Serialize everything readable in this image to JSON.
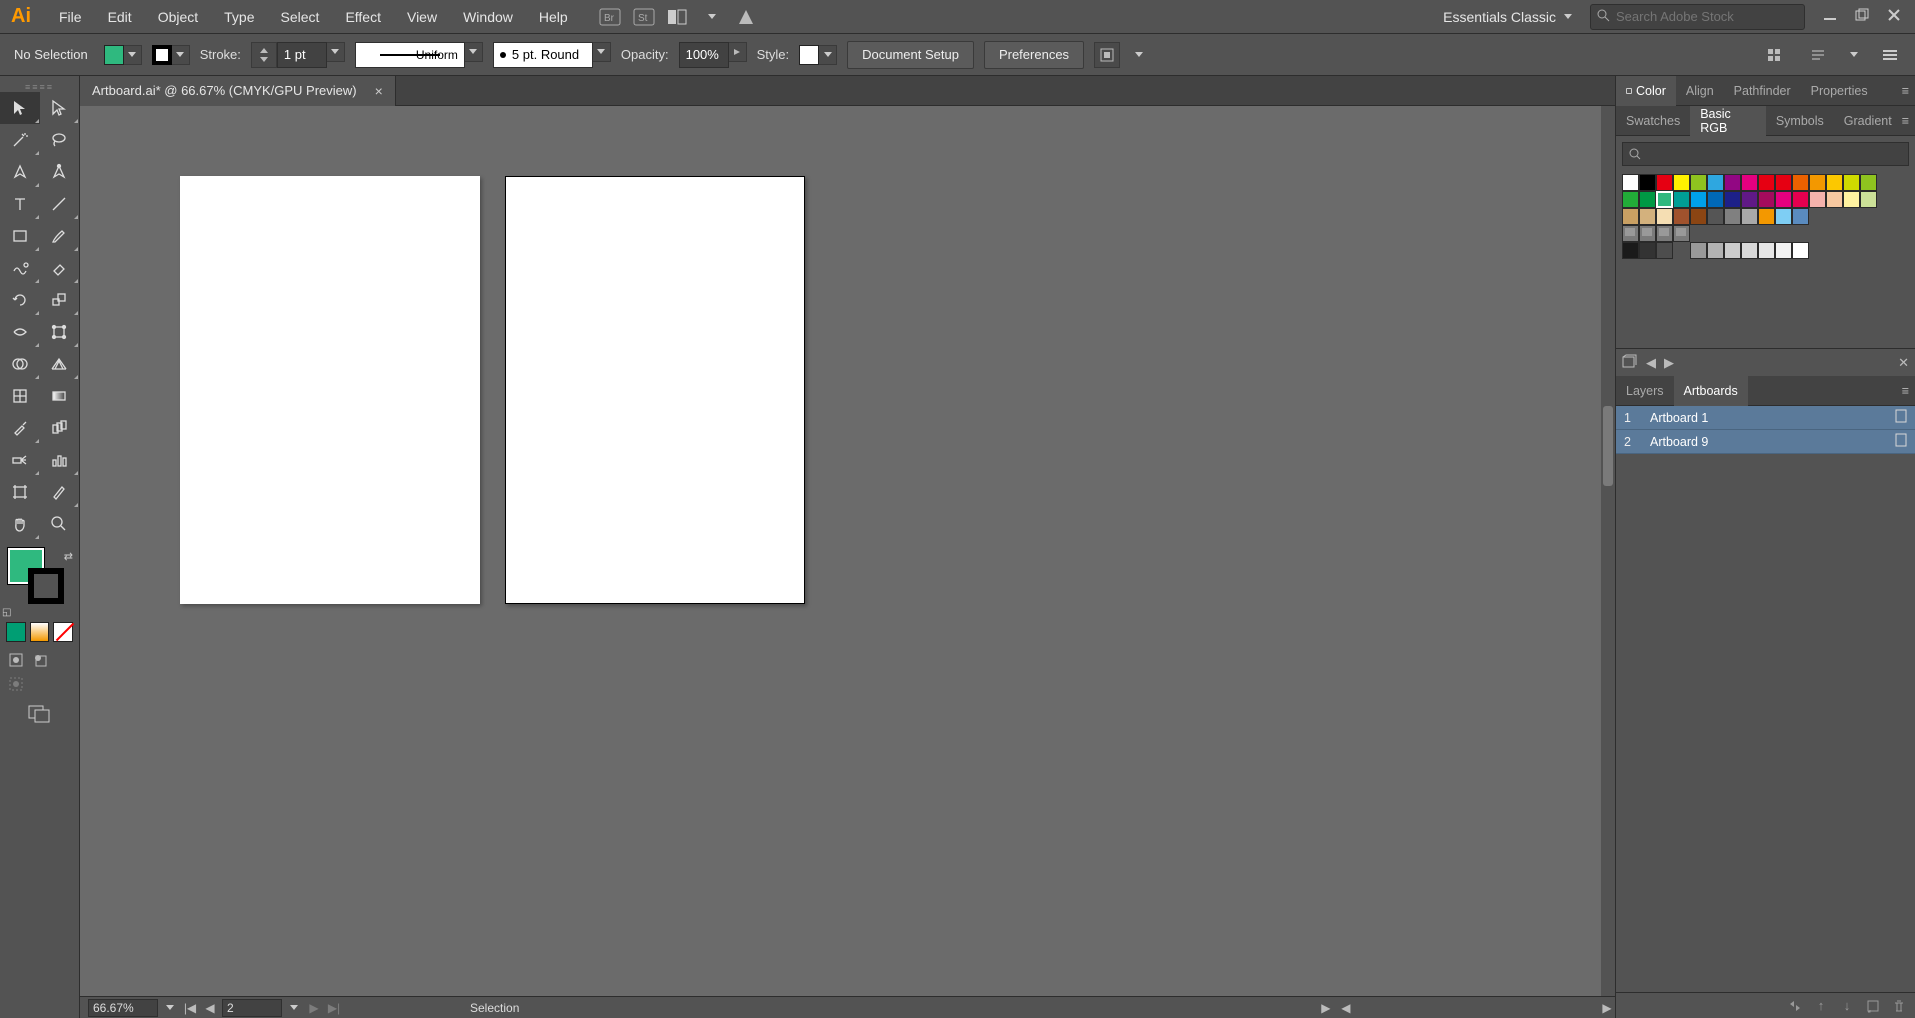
{
  "menu": {
    "items": [
      "File",
      "Edit",
      "Object",
      "Type",
      "Select",
      "Effect",
      "View",
      "Window",
      "Help"
    ]
  },
  "workspace": {
    "name": "Essentials Classic"
  },
  "search": {
    "placeholder": "Search Adobe Stock"
  },
  "options": {
    "selection": "No Selection",
    "fill_color": "#2fb97f",
    "stroke_color": "#000000",
    "stroke_label": "Stroke:",
    "stroke_weight": "1 pt",
    "profile_label": "Uniform",
    "brush_label": "5 pt. Round",
    "opacity_label": "Opacity:",
    "opacity_value": "100%",
    "style_label": "Style:",
    "btn_docsetup": "Document Setup",
    "btn_prefs": "Preferences"
  },
  "doc_tab": {
    "title": "Artboard.ai* @ 66.67% (CMYK/GPU Preview)"
  },
  "status": {
    "zoom": "66.67%",
    "artboard_num": "2",
    "tool": "Selection"
  },
  "right_tabs1": [
    "Color",
    "Align",
    "Pathfinder",
    "Properties"
  ],
  "right_tabs2": [
    "Swatches",
    "Basic RGB",
    "Symbols",
    "Gradient"
  ],
  "swatches_row1": [
    "#ffffff",
    "#000000",
    "#e60012",
    "#fff100",
    "#8fc31f",
    "#2ea7e0",
    "#920783",
    "#e4007f",
    "#e60012",
    "#e60012",
    "#eb6100",
    "#f39800",
    "#fcc800",
    "#cfdb00",
    "#8fc31f"
  ],
  "swatches_row2": [
    "#22ac38",
    "#009944",
    "#2fb97f",
    "#009e96",
    "#00a0e9",
    "#0068b7",
    "#1d2088",
    "#601986",
    "#a40b5d",
    "#e4007f",
    "#e5004f",
    "#f5b2ac",
    "#f7c8a0",
    "#fff2a0",
    "#cce198"
  ],
  "swatches_row3": [
    "#c9a063",
    "#d3b17d",
    "#f5deb3",
    "#a0522d",
    "#8b4513",
    "#555555",
    "#808080",
    "#a9a9a9",
    "#f39800",
    "#7ecef4",
    "#5a8bbf"
  ],
  "swatches_row4_folders": 4,
  "swatches_row5": [
    "#1a1a1a",
    "#333333",
    "#4d4d4d",
    "",
    "#999999",
    "#b3b3b3",
    "#cccccc",
    "#d9d9d9",
    "#e6e6e6",
    "#f2f2f2",
    "#ffffff"
  ],
  "right_tabs3": [
    "Layers",
    "Artboards"
  ],
  "artboards": [
    {
      "index": "1",
      "name": "Artboard 1"
    },
    {
      "index": "2",
      "name": "Artboard 9"
    }
  ]
}
